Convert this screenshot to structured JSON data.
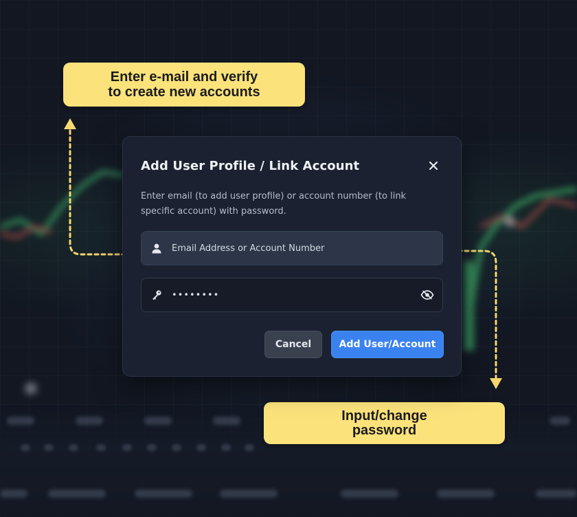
{
  "dialog": {
    "title": "Add User Profile / Link Account",
    "description": "Enter email (to add user profile) or account number (to link specific account) with password.",
    "email_field": {
      "placeholder": "Email Address or Account Number",
      "value": ""
    },
    "password_field": {
      "value": "••••••••"
    },
    "cancel_label": "Cancel",
    "submit_label": "Add User/Account"
  },
  "callouts": {
    "email_line1": "Enter e-mail and verify",
    "email_line2": "to create new accounts",
    "password_line1": "Input/change",
    "password_line2": "password"
  },
  "icons": {
    "close": "close-icon",
    "user": "user-icon",
    "key": "key-icon",
    "eye": "eye-icon"
  },
  "colors": {
    "accent": "#3a82f0",
    "callout": "#fbe27b",
    "connector": "#f5d76e",
    "dialog_bg": "#1b2130",
    "page_bg": "#121722"
  }
}
